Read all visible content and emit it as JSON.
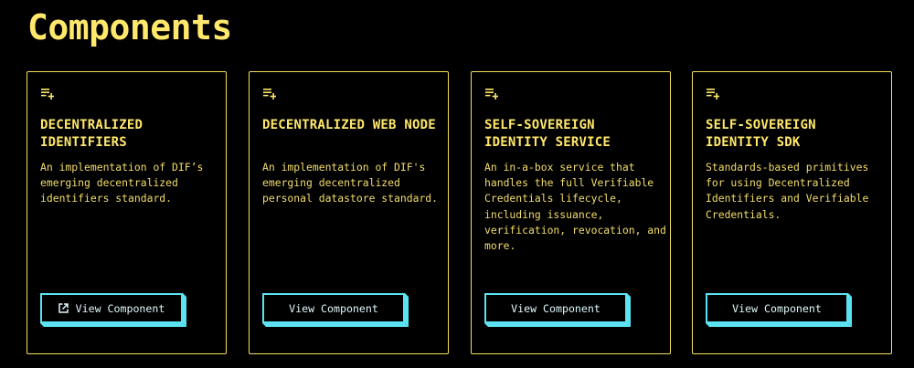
{
  "page": {
    "title": "Components"
  },
  "colors": {
    "accent_yellow": "#ffe86b",
    "border_yellow": "#f7e05f",
    "button_cyan": "#5be3f2",
    "background": "#000000"
  },
  "cards": [
    {
      "icon": "playlist-add-icon",
      "title": "DECENTRALIZED IDENTIFIERS",
      "description": "An implementation of DIF’s emerging decentralized identifiers standard.",
      "button_label": "View Component",
      "button_icon": "external-link-icon"
    },
    {
      "icon": "playlist-add-icon",
      "title": "DECENTRALIZED WEB NODE",
      "description": "An implementation of DIF's emerging decentralized personal datastore standard.",
      "button_label": "View Component"
    },
    {
      "icon": "playlist-add-icon",
      "title": "SELF-SOVEREIGN IDENTITY SERVICE",
      "description": "An in-a-box service that handles the full Verifiable Credentials lifecycle, including issuance, verification, revocation, and more.",
      "button_label": "View Component"
    },
    {
      "icon": "playlist-add-icon",
      "title": "SELF-SOVEREIGN IDENTITY SDK",
      "description": "Standards-based primitives for using Decentralized Identifiers and Verifiable Credentials.",
      "button_label": "View Component"
    }
  ]
}
